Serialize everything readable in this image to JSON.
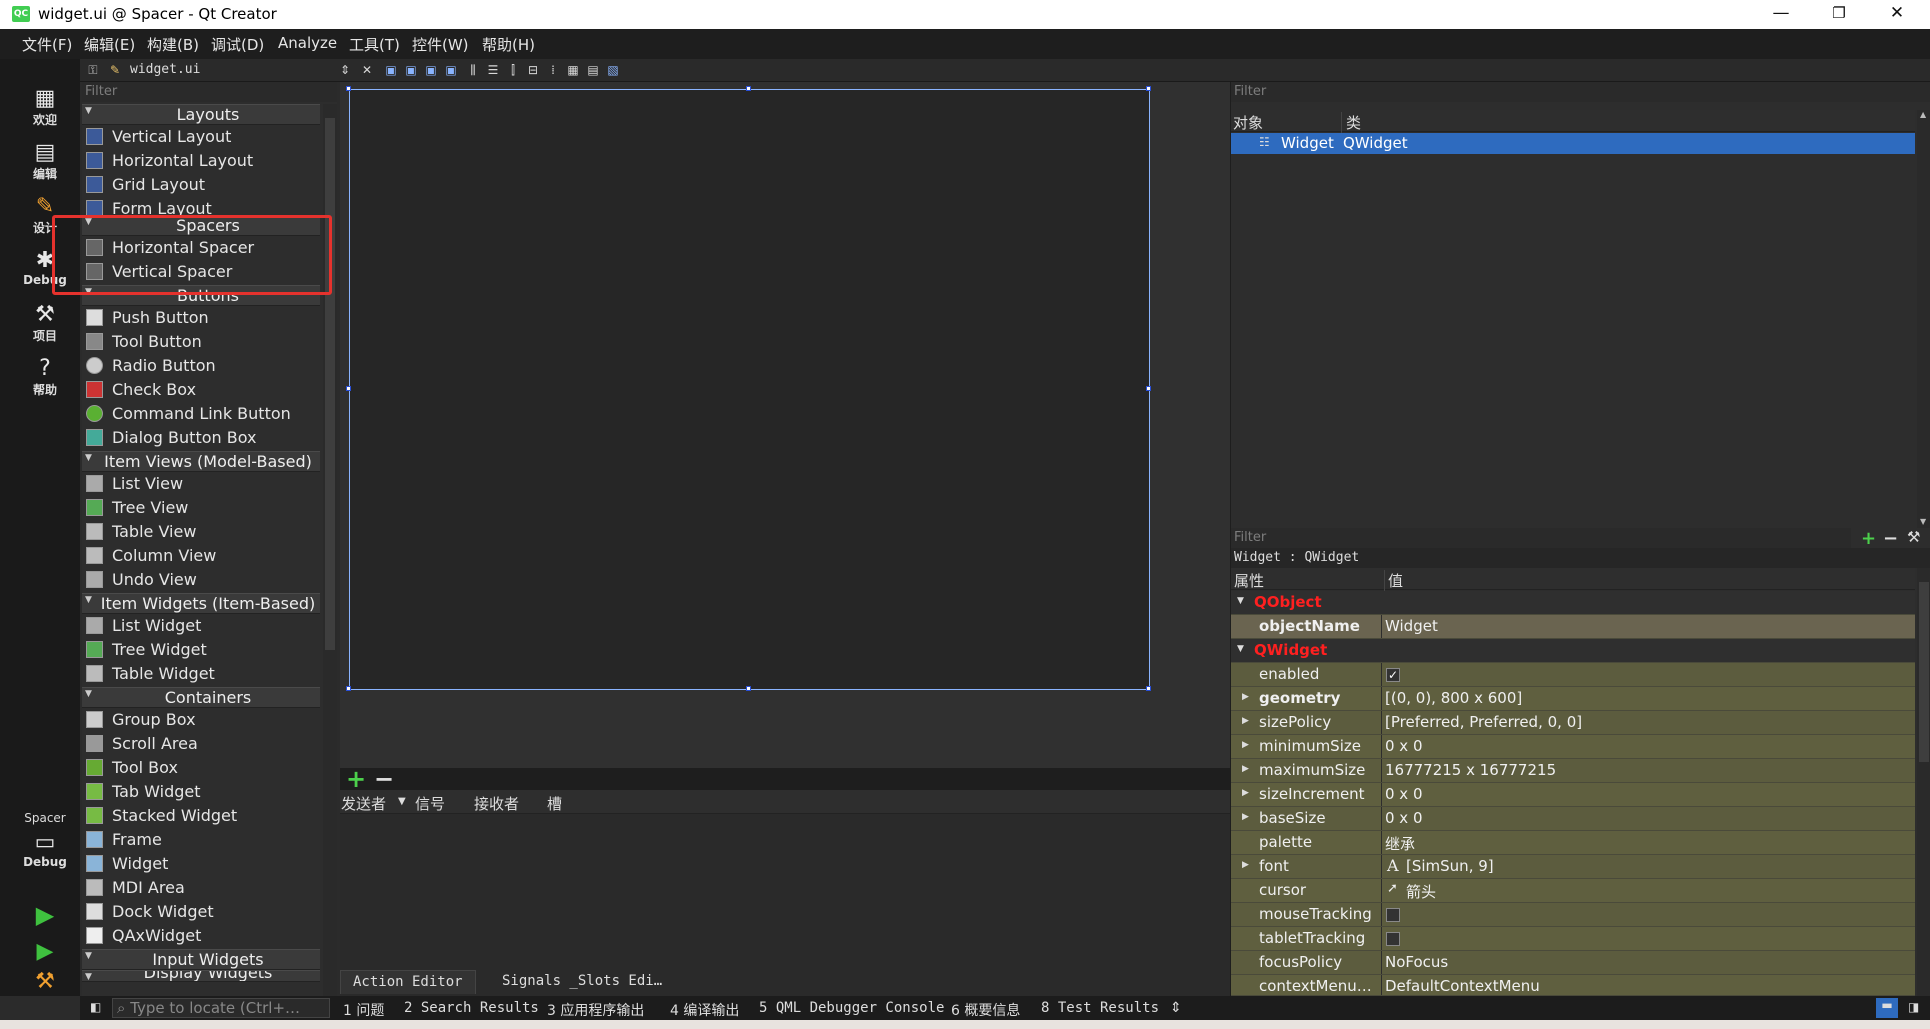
{
  "window": {
    "title": "widget.ui @ Spacer - Qt Creator",
    "logo": "QC",
    "controls": [
      "—",
      "❐",
      "✕"
    ]
  },
  "menu": [
    "文件(F)",
    "编辑(E)",
    "构建(B)",
    "调试(D)",
    "Analyze",
    "工具(T)",
    "控件(W)",
    "帮助(H)"
  ],
  "modes": [
    {
      "label": "欢迎",
      "icon": "grid-icon"
    },
    {
      "label": "编辑",
      "icon": "document-icon"
    },
    {
      "label": "设计",
      "icon": "pencil-icon"
    },
    {
      "label": "Debug",
      "icon": "bug-icon"
    },
    {
      "label": "项目",
      "icon": "wrench-icon"
    },
    {
      "label": "帮助",
      "icon": "help-icon"
    }
  ],
  "kit": {
    "project": "Spacer",
    "config": "Debug"
  },
  "toolbar": {
    "file": "widget.ui"
  },
  "widget_box": {
    "filter_placeholder": "Filter",
    "layouts": {
      "title": "Layouts",
      "items": [
        "Vertical Layout",
        "Horizontal Layout",
        "Grid Layout",
        "Form Layout"
      ]
    },
    "spacers": {
      "title": "Spacers",
      "items": [
        "Horizontal Spacer",
        "Vertical Spacer"
      ]
    },
    "buttons": {
      "title": "Buttons",
      "items": [
        "Push Button",
        "Tool Button",
        "Radio Button",
        "Check Box",
        "Command Link Button",
        "Dialog Button Box"
      ]
    },
    "item_views": {
      "title": "Item Views (Model-Based)",
      "items": [
        "List View",
        "Tree View",
        "Table View",
        "Column View",
        "Undo View"
      ]
    },
    "item_widgets": {
      "title": "Item Widgets (Item-Based)",
      "items": [
        "List Widget",
        "Tree Widget",
        "Table Widget"
      ]
    },
    "containers": {
      "title": "Containers",
      "items": [
        "Group Box",
        "Scroll Area",
        "Tool Box",
        "Tab Widget",
        "Stacked Widget",
        "Frame",
        "Widget",
        "MDI Area",
        "Dock Widget",
        "QAxWidget"
      ]
    },
    "input_widgets": {
      "title": "Input Widgets"
    },
    "display_widgets": {
      "title": "Display Widgets"
    }
  },
  "signals": {
    "headers": [
      "发送者",
      "信号",
      "接收者",
      "槽"
    ],
    "tabs": [
      "Action Editor",
      "Signals _Slots Edi…"
    ]
  },
  "object_inspector": {
    "filter_placeholder": "Filter",
    "headers": [
      "对象",
      "类"
    ],
    "row": {
      "object": "Widget",
      "class": "QWidget"
    }
  },
  "property_editor": {
    "filter_placeholder": "Filter",
    "class_label": "Widget : QWidget",
    "headers": [
      "属性",
      "值"
    ],
    "group_qobject": "QObject",
    "group_qwidget": "QWidget",
    "rows": [
      {
        "name": "objectName",
        "value": "Widget"
      },
      {
        "name": "enabled",
        "value": "✓"
      },
      {
        "name": "geometry",
        "value": "[(0, 0), 800 x 600]"
      },
      {
        "name": "sizePolicy",
        "value": "[Preferred, Preferred, 0, 0]"
      },
      {
        "name": "minimumSize",
        "value": "0 x 0"
      },
      {
        "name": "maximumSize",
        "value": "16777215 x 16777215"
      },
      {
        "name": "sizeIncrement",
        "value": "0 x 0"
      },
      {
        "name": "baseSize",
        "value": "0 x 0"
      },
      {
        "name": "palette",
        "value": "继承"
      },
      {
        "name": "font",
        "value": "[SimSun, 9]"
      },
      {
        "name": "cursor",
        "value": "箭头"
      },
      {
        "name": "mouseTracking",
        "value": ""
      },
      {
        "name": "tabletTracking",
        "value": ""
      },
      {
        "name": "focusPolicy",
        "value": "NoFocus"
      },
      {
        "name": "contextMenu…",
        "value": "DefaultContextMenu"
      }
    ]
  },
  "statusbar": {
    "locator_placeholder": "Type to locate (Ctrl+…",
    "panes": [
      "1 问题",
      "2 Search Results",
      "3 应用程序输出",
      "4 编译输出",
      "5 QML Debugger Console",
      "6 概要信息",
      "8 Test Results"
    ]
  },
  "colors": {
    "highlight": "#e5322d",
    "selection": "#2e6bbf",
    "property_group": "#ff2020"
  }
}
